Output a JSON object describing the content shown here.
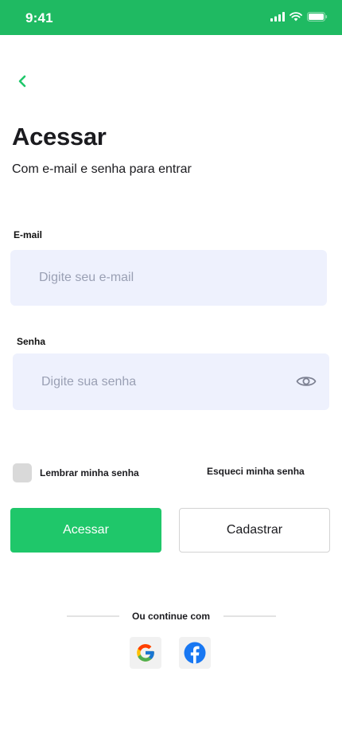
{
  "status_bar": {
    "time": "9:41",
    "background": "#1fba62"
  },
  "header": {
    "back_icon": "chevron-left-icon",
    "title": "Acessar",
    "subtitle": "Com e-mail e senha para entrar"
  },
  "form": {
    "email": {
      "label": "E-mail",
      "placeholder": "Digite seu e-mail",
      "value": ""
    },
    "password": {
      "label": "Senha",
      "placeholder": "Digite sua senha",
      "value": "",
      "toggle_icon": "eye-icon"
    },
    "remember": {
      "label": "Lembrar minha senha",
      "checked": false
    },
    "forgot_label": "Esqueci minha senha"
  },
  "actions": {
    "login_label": "Acessar",
    "register_label": "Cadastrar"
  },
  "social": {
    "divider_text": "Ou continue com",
    "providers": [
      "google-icon",
      "facebook-icon"
    ]
  },
  "colors": {
    "accent": "#1fc76a",
    "input_bg": "#eef1fd",
    "placeholder": "#9aa0b4"
  }
}
